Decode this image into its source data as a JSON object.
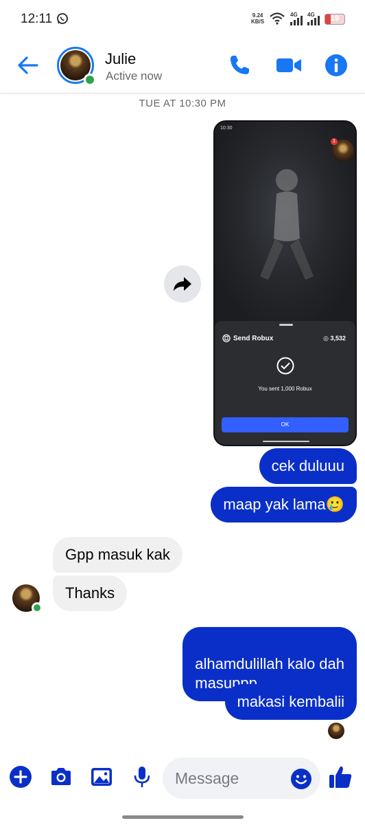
{
  "status_bar": {
    "time": "12:11",
    "net_speed_value": "9.24",
    "net_speed_unit": "KB/S",
    "sig1_label": "4G",
    "sig2_label": "4G",
    "battery": "19"
  },
  "header": {
    "name": "Julie",
    "status": "Active now"
  },
  "chat": {
    "timestamp": "TUE AT 10:30 PM",
    "screenshot": {
      "status_time": "10:30",
      "send_title": "Send Robux",
      "balance": "3,532",
      "sent_text": "You sent 1,000 Robux",
      "ok_label": "OK",
      "badge": "1"
    },
    "messages": [
      {
        "from": "me",
        "text": "cek duluuu"
      },
      {
        "from": "me",
        "text": "maap yak lama🥲"
      },
      {
        "from": "them",
        "text": "Gpp masuk kak"
      },
      {
        "from": "them",
        "text": "Thanks"
      },
      {
        "from": "me",
        "text": "alhamdulillah kalo dah\nmasuppp"
      },
      {
        "from": "me",
        "text": "makasi kembalii"
      }
    ]
  },
  "composer": {
    "placeholder": "Message"
  },
  "colors": {
    "accent": "#0a2fc9",
    "header_icons": "#1877f2",
    "online": "#31a24c"
  }
}
